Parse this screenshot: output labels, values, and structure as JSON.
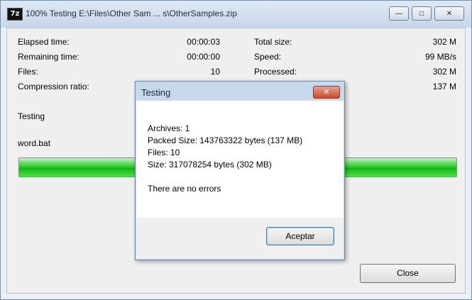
{
  "window": {
    "title": "100% Testing E:\\Files\\Other Sam ... s\\OtherSamples.zip",
    "app_icon_text": "7z"
  },
  "stats": {
    "elapsed_label": "Elapsed time:",
    "elapsed_value": "00:00:03",
    "remaining_label": "Remaining time:",
    "remaining_value": "00:00:00",
    "files_label": "Files:",
    "files_value": "10",
    "compression_label": "Compression ratio:",
    "total_size_label": "Total size:",
    "total_size_value": "302 M",
    "speed_label": "Speed:",
    "speed_value": "99 MB/s",
    "processed_label": "Processed:",
    "processed_value": "302 M",
    "compressed_value": "137 M"
  },
  "operation": "Testing",
  "current_file": "word.bat",
  "progress_percent": 100,
  "close_label": "Close",
  "dialog": {
    "title": "Testing",
    "archives": "Archives: 1",
    "packed_size": "Packed Size: 143763322 bytes (137 MB)",
    "files": "Files: 10",
    "size": "Size: 317078254 bytes (302 MB)",
    "message": "There are no errors",
    "ok_label": "Aceptar"
  },
  "colors": {
    "progress_fill": "#22c322",
    "window_frame": "#c7d6ea"
  }
}
